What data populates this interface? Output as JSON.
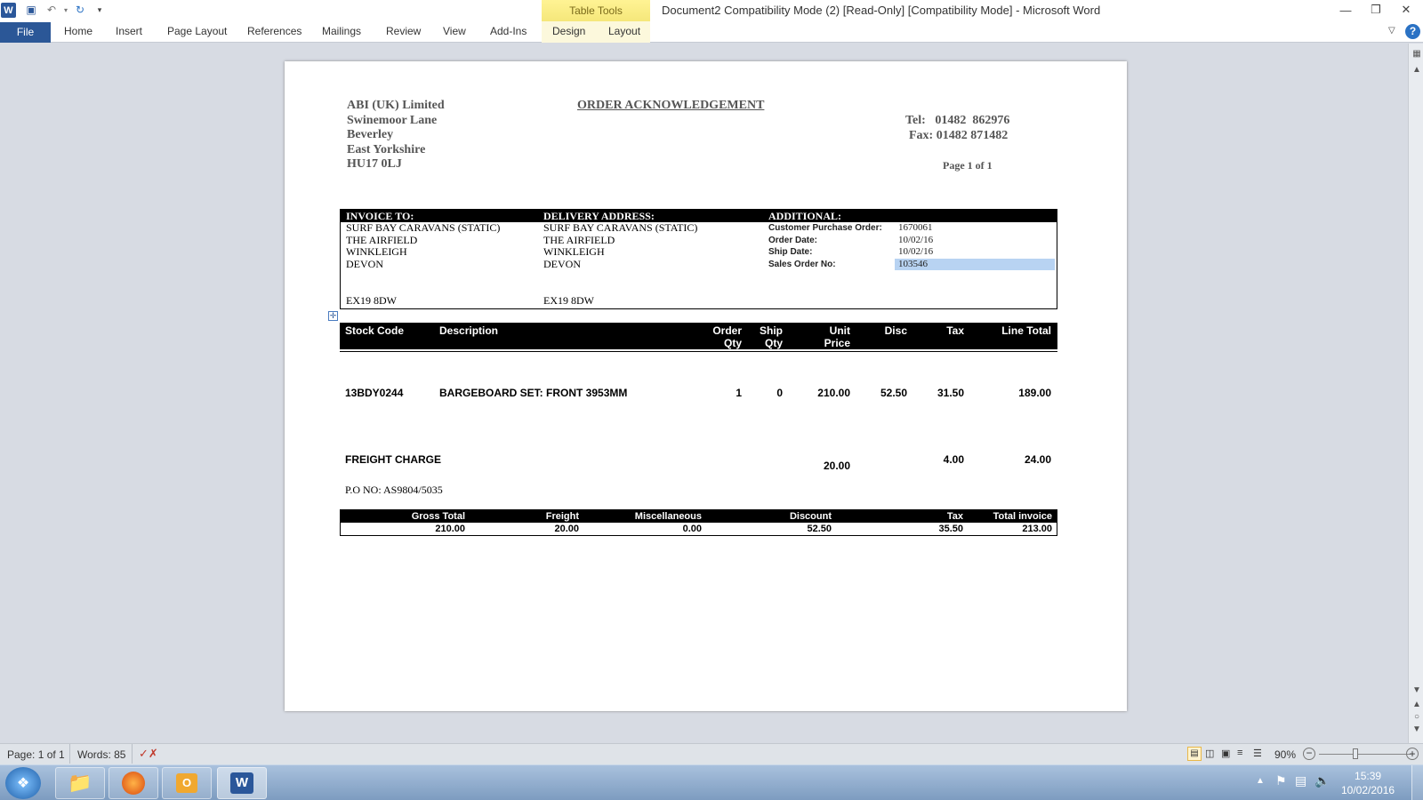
{
  "window": {
    "title": "Document2 Compatibility Mode (2) [Read-Only] [Compatibility Mode]  -  Microsoft Word",
    "context_tab_group": "Table Tools"
  },
  "ribbon": {
    "tabs": [
      "File",
      "Home",
      "Insert",
      "Page Layout",
      "References",
      "Mailings",
      "Review",
      "View",
      "Add-Ins",
      "Design",
      "Layout"
    ]
  },
  "document": {
    "company_lines": [
      "ABI (UK) Limited",
      "Swinemoor Lane",
      "Beverley",
      "East Yorkshire",
      "HU17 0LJ"
    ],
    "heading": "ORDER ACKNOWLEDGEMENT",
    "tel": "Tel:   01482  862976",
    "fax": "Fax: 01482 871482",
    "page_count": "Page 1 of 1",
    "invoice_to": {
      "label": "INVOICE TO:",
      "lines": [
        "SURF BAY CARAVANS (STATIC)",
        "THE AIRFIELD",
        "WINKLEIGH",
        "DEVON"
      ],
      "postcode": "EX19 8DW"
    },
    "delivery": {
      "label": "DELIVERY ADDRESS:",
      "lines": [
        "SURF BAY CARAVANS (STATIC)",
        "THE AIRFIELD",
        "WINKLEIGH",
        "DEVON"
      ],
      "postcode": "EX19 8DW"
    },
    "additional": {
      "label": "ADDITIONAL:",
      "customer_po_label": "Customer Purchase Order:",
      "customer_po": "1670061",
      "order_date_label": "Order Date:",
      "order_date": "10/02/16",
      "ship_date_label": "Ship Date:",
      "ship_date": "10/02/16",
      "sales_order_label": "Sales Order No:",
      "sales_order": "103546"
    },
    "items_header": {
      "stock_code": "Stock Code",
      "description": "Description",
      "order_qty_1": "Order",
      "order_qty_2": "Qty",
      "ship_qty_1": "Ship",
      "ship_qty_2": "Qty",
      "unit_price_1": "Unit",
      "unit_price_2": "Price",
      "disc": "Disc",
      "tax": "Tax",
      "line_total": "Line Total"
    },
    "item": {
      "stock_code": "13BDY0244",
      "description": "BARGEBOARD SET: FRONT 3953MM",
      "order_qty": "1",
      "ship_qty": "0",
      "unit_price": "210.00",
      "disc": "52.50",
      "tax": "31.50",
      "line_total": "189.00"
    },
    "freight": {
      "label": "FREIGHT CHARGE",
      "price": "20.00",
      "tax": "4.00",
      "total": "24.00"
    },
    "po_note": "P.O NO: AS9804/5035",
    "totals": {
      "gross_total_label": "Gross Total",
      "gross_total": "210.00",
      "freight_label": "Freight",
      "freight": "20.00",
      "misc_label": "Miscellaneous",
      "misc": "0.00",
      "discount_label": "Discount",
      "discount": "52.50",
      "tax_label": "Tax",
      "tax": "35.50",
      "total_label": "Total invoice",
      "total": "213.00"
    }
  },
  "status": {
    "page": "Page: 1 of 1",
    "words": "Words: 85",
    "zoom": "90%"
  },
  "clock": {
    "time": "15:39",
    "date": "10/02/2016"
  },
  "colors": {
    "file_tab": "#2b5797",
    "context_tab": "#f5e77a",
    "selection": "#b8d3f2"
  }
}
